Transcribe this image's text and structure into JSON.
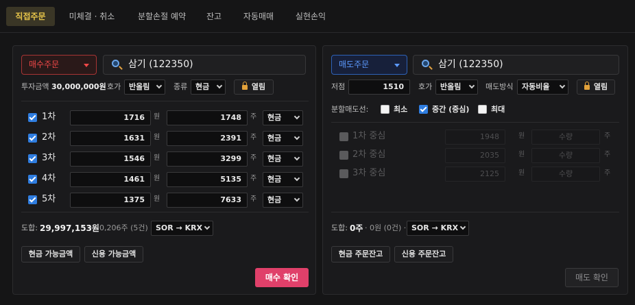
{
  "tabs": [
    "직접주문",
    "미체결 · 취소",
    "분할손절 예약",
    "잔고",
    "자동매매",
    "실현손익"
  ],
  "buy": {
    "order_type": "매수주문",
    "stock": "삼기 (122350)",
    "invest_label": "투자금액",
    "invest_value": "30,000,000원",
    "hoga_label": "호가",
    "hoga_value": "반올림",
    "kind_label": "종류",
    "kind_value": "현금",
    "open_label": "열림",
    "unit_won": "원",
    "unit_ju": "주",
    "rows": [
      {
        "tier": "1차",
        "price": "1716",
        "qty": "1748",
        "kind": "현금"
      },
      {
        "tier": "2차",
        "price": "1631",
        "qty": "2391",
        "kind": "현금"
      },
      {
        "tier": "3차",
        "price": "1546",
        "qty": "3299",
        "kind": "현금"
      },
      {
        "tier": "4차",
        "price": "1461",
        "qty": "5135",
        "kind": "현금"
      },
      {
        "tier": "5차",
        "price": "1375",
        "qty": "7633",
        "kind": "현금"
      }
    ],
    "total_label": "도합:",
    "total_value": "29,997,153원",
    "total_detail": "· 20,206주 (5건) ·",
    "route": "SOR → KRX",
    "cash_btn": "현금 가능금액",
    "credit_btn": "신용 가능금액",
    "confirm": "매수 확인"
  },
  "sell": {
    "order_type": "매도주문",
    "stock": "삼기 (122350)",
    "low_label": "저점",
    "low_value": "1510",
    "hoga_label": "호가",
    "hoga_value": "반올림",
    "method_label": "매도방식",
    "method_value": "자동비율",
    "open_label": "열림",
    "split_label": "분할매도선:",
    "opt_min": "최소",
    "opt_mid": "중간 (중심)",
    "opt_max": "최대",
    "unit_won": "원",
    "unit_ju": "주",
    "rows": [
      {
        "tier": "1차 중심",
        "price": "1948",
        "qty": "수량"
      },
      {
        "tier": "2차 중심",
        "price": "2035",
        "qty": "수량"
      },
      {
        "tier": "3차 중심",
        "price": "2125",
        "qty": "수량"
      }
    ],
    "total_label": "도합:",
    "total_value": "0주",
    "total_detail": "· 0원 (0건) ·",
    "route": "SOR → KRX",
    "cash_btn": "현금 주문잔고",
    "credit_btn": "신용 주문잔고",
    "confirm": "매도 확인"
  },
  "colors": {
    "buy_accent": "#f04848",
    "sell_accent": "#5c9aff",
    "buy_confirm": "#e0406a",
    "active_tab": "#e8c64a"
  }
}
